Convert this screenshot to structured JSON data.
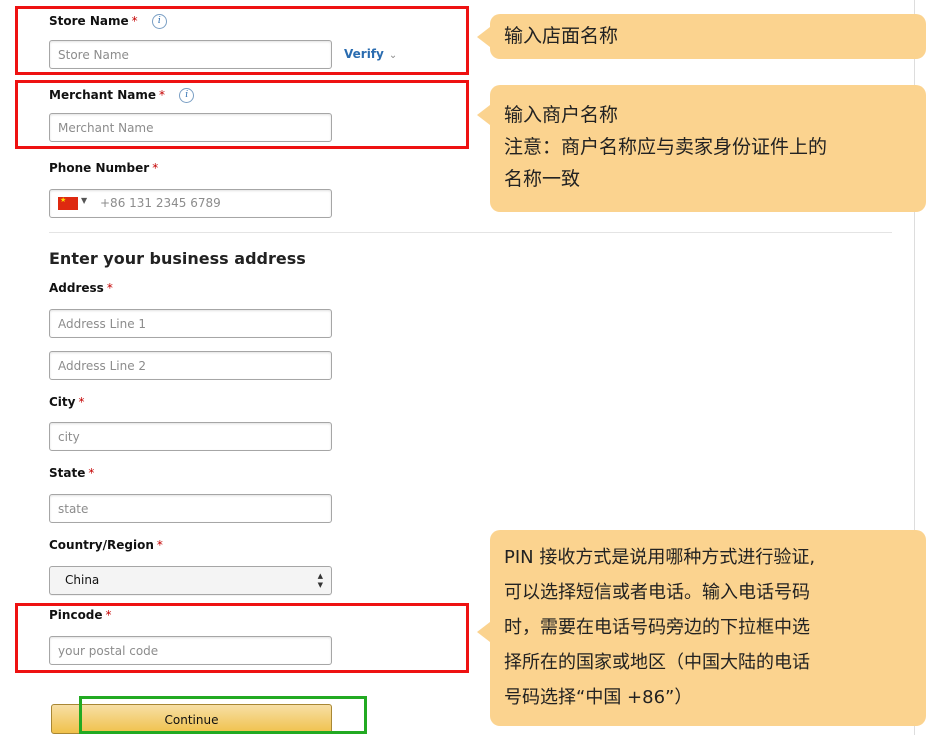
{
  "store_name": {
    "label": "Store Name",
    "required": "*",
    "placeholder": "Store Name",
    "verify_label": "Verify",
    "verify_chevron": "⌄"
  },
  "merchant_name": {
    "label": "Merchant Name",
    "required": "*",
    "placeholder": "Merchant Name"
  },
  "phone": {
    "label": "Phone Number",
    "required": "*",
    "value": "+86 131 2345 6789",
    "flag_icon": "china-flag-icon"
  },
  "address_section": {
    "title": "Enter your business address"
  },
  "address": {
    "label": "Address",
    "required": "*",
    "line1_placeholder": "Address Line 1",
    "line2_placeholder": "Address Line 2"
  },
  "city": {
    "label": "City",
    "required": "*",
    "placeholder": "city"
  },
  "state": {
    "label": "State",
    "required": "*",
    "placeholder": "state"
  },
  "country": {
    "label": "Country/Region",
    "required": "*",
    "selected": "China"
  },
  "pincode": {
    "label": "Pincode",
    "required": "*",
    "placeholder": "your postal code"
  },
  "continue_label": "Continue",
  "callouts": {
    "store": {
      "line1": "输入店面名称"
    },
    "merchant": {
      "line1": "输入商户名称",
      "line2": "注意：商户名称应与卖家身份证件上的",
      "line3": "名称一致"
    },
    "pin": {
      "line1": "PIN 接收方式是说用哪种方式进行验证,",
      "line2": "可以选择短信或者电话。输入电话号码",
      "line3": "时，需要在电话号码旁边的下拉框中选",
      "line4": "择所在的国家或地区（中国大陆的电话",
      "line5": "号码选择“中国 +86”）"
    }
  },
  "colors": {
    "highlight_red": "#ee1111",
    "highlight_green": "#22aa22",
    "callout_bg": "#fbd38f",
    "link_blue": "#2a6cb0",
    "button_gold": "#f0c14b"
  }
}
